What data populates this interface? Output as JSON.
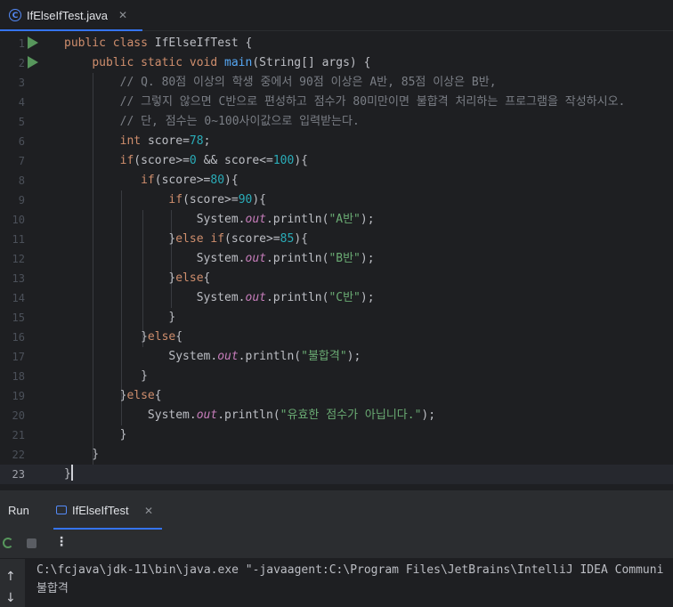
{
  "editor_tab": {
    "filename": "IfElseIfTest.java",
    "icon": "java-class-icon",
    "close_glyph": "✕"
  },
  "gutter": {
    "line_numbers": [
      "1",
      "2",
      "3",
      "4",
      "5",
      "6",
      "7",
      "8",
      "9",
      "10",
      "11",
      "12",
      "13",
      "14",
      "15",
      "16",
      "17",
      "18",
      "19",
      "20",
      "21",
      "22",
      "23"
    ],
    "run_markers_on_lines": [
      1,
      2
    ],
    "current_line": 23
  },
  "code_lines": [
    "public class IfElseIfTest {",
    "    public static void main(String[] args) {",
    "        // Q. 80점 이상의 학생 중에서 90점 이상은 A반, 85점 이상은 B반,",
    "        // 그렇지 않으면 C반으로 편성하고 점수가 80미만이면 불합격 처리하는 프로그램을 작성하시오.",
    "        // 단, 점수는 0~100사이값으로 입력받는다.",
    "        int score=78;",
    "        if(score>=0 && score<=100){",
    "           if(score>=80){",
    "               if(score>=90){",
    "                   System.out.println(\"A반\");",
    "               }else if(score>=85){",
    "                   System.out.println(\"B반\");",
    "               }else{",
    "                   System.out.println(\"C반\");",
    "               }",
    "           }else{",
    "               System.out.println(\"불합격\");",
    "           }",
    "        }else{",
    "            System.out.println(\"유효한 점수가 아닙니다.\");",
    "        }",
    "    }",
    "}"
  ],
  "run_panel": {
    "title": "Run",
    "tab_label": "IfElseIfTest",
    "close_glyph": "✕",
    "more_glyph": "⋮"
  },
  "console": {
    "command_line": "C:\\fcjava\\jdk-11\\bin\\java.exe \"-javaagent:C:\\Program Files\\JetBrains\\IntelliJ IDEA Communi",
    "output_line": "불합격",
    "up_glyph": "↑",
    "down_glyph": "↓"
  },
  "colors": {
    "background": "#1e1f22",
    "keyword": "#cf8e6d",
    "method": "#56a8f5",
    "string": "#6aab73",
    "number": "#2aacb8",
    "comment": "#7a7e85",
    "static_field": "#c77dbb",
    "accent": "#3574f0",
    "run_green": "#57965c"
  }
}
